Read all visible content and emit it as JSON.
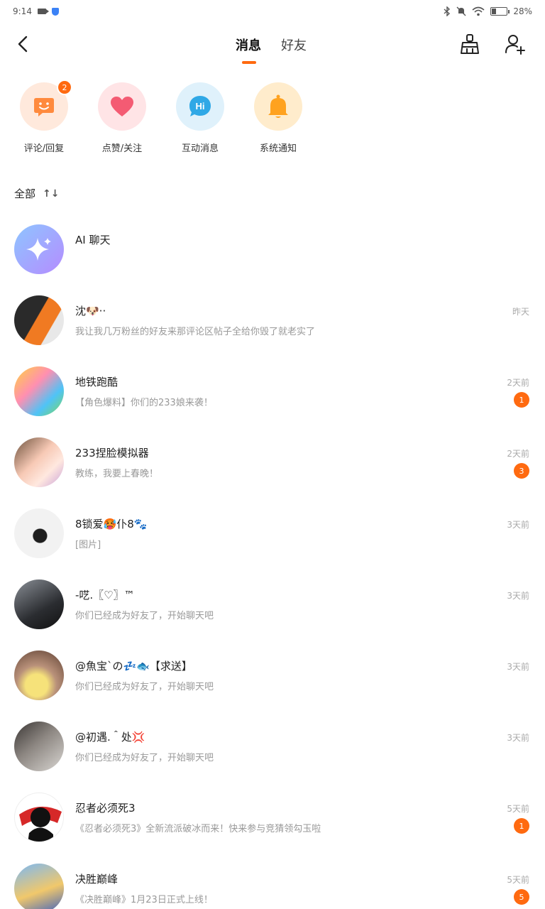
{
  "status_bar": {
    "time": "9:14",
    "battery_percent": "28%",
    "battery_level": 0.28
  },
  "header": {
    "tabs": [
      {
        "label": "消息",
        "active": true
      },
      {
        "label": "好友",
        "active": false
      }
    ]
  },
  "quick_actions": [
    {
      "label": "评论/回复",
      "icon": "smile-chat-icon",
      "badge": "2",
      "bg": "#ffe9dc",
      "color": "#ff8a3d"
    },
    {
      "label": "点赞/关注",
      "icon": "heart-icon",
      "badge": "",
      "bg": "#ffe4e6",
      "color": "#f45b73"
    },
    {
      "label": "互动消息",
      "icon": "hi-chat-icon",
      "badge": "",
      "bg": "#dff1fb",
      "color": "#2fa8e6"
    },
    {
      "label": "系统通知",
      "icon": "bell-icon",
      "badge": "",
      "bg": "#ffeccc",
      "color": "#ffa21f"
    }
  ],
  "section": {
    "title": "全部",
    "sort_label": "↑↓"
  },
  "conversations": [
    {
      "name": "AI 聊天",
      "preview": "",
      "time": "",
      "badge": "",
      "avatar_colors": [
        "#8ec5ff",
        "#b58cff"
      ]
    },
    {
      "name": "沈🐶··",
      "preview": "我让我几万粉丝的好友来那评论区帖子全给你毁了就老实了",
      "time": "昨天",
      "badge": "",
      "avatar_colors": [
        "#f07a22",
        "#2a2a2a"
      ]
    },
    {
      "name": "地铁跑酷",
      "preview": "【角色爆料】你们的233娘来袭！",
      "time": "2天前",
      "badge": "1",
      "avatar_colors": [
        "#ffd23f",
        "#4fc3f7"
      ]
    },
    {
      "name": "233捏脸模拟器",
      "preview": "教练，我要上春晚！",
      "time": "2天前",
      "badge": "3",
      "avatar_colors": [
        "#f7c9b5",
        "#6b4f3a"
      ]
    },
    {
      "name": "8锁爱🥵仆8🐾",
      "preview": "[图片]",
      "time": "3天前",
      "badge": "",
      "avatar_colors": [
        "#f2f2f2",
        "#1e1e1e"
      ]
    },
    {
      "name": "-呓.〖♡〗™",
      "preview": "你们已经成为好友了，开始聊天吧",
      "time": "3天前",
      "badge": "",
      "avatar_colors": [
        "#8a8f96",
        "#2b2d31"
      ]
    },
    {
      "name": "@魚宝`の💤🐟【求送】",
      "preview": "你们已经成为好友了，开始聊天吧",
      "time": "3天前",
      "badge": "",
      "avatar_colors": [
        "#f6e27a",
        "#b9917a"
      ]
    },
    {
      "name": "@初遇.＾处💢",
      "preview": "你们已经成为好友了，开始聊天吧",
      "time": "3天前",
      "badge": "",
      "avatar_colors": [
        "#d9d6d2",
        "#3a3634"
      ]
    },
    {
      "name": "忍者必须死3",
      "preview": "《忍者必须死3》全新流派破冰而来！快来参与竞猜领勾玉啦",
      "time": "5天前",
      "badge": "1",
      "avatar_colors": [
        "#d62828",
        "#111111"
      ]
    },
    {
      "name": "决胜巅峰",
      "preview": "《决胜巅峰》1月23日正式上线！",
      "time": "5天前",
      "badge": "5",
      "avatar_colors": [
        "#7bb8f5",
        "#f1c86b"
      ]
    }
  ]
}
